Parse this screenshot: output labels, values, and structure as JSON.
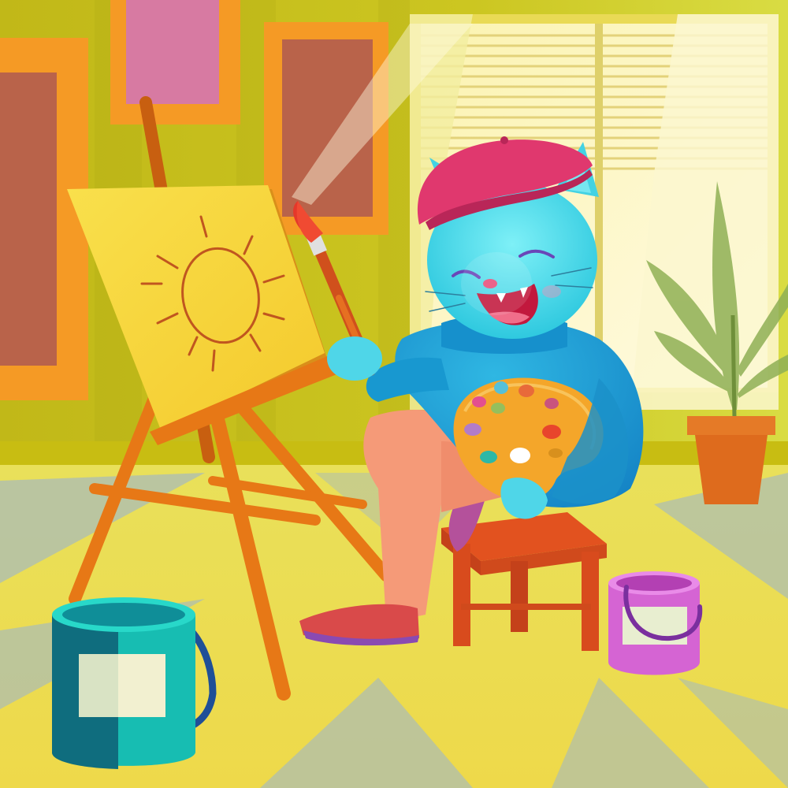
{
  "scene": {
    "subject": "cat-painter",
    "palette": {
      "wall": "#c9c31b",
      "wall_light": "#dcd93a",
      "floor_light": "#f3eb6a",
      "floor_blue": "#a9bcb8",
      "frame_orange": "#f59a25",
      "frame_pink": "#d77aa2",
      "frame_red": "#b9634a",
      "window_light": "#fff8c8",
      "easel_wood": "#e77816",
      "canvas": "#f7d73a",
      "sun_sketch": "#c0561f",
      "cat_fur": "#45d7e6",
      "sweater": "#1aa0d4",
      "pants": "#f59a78",
      "beret": "#e0386e",
      "shoe": "#d94a4a",
      "stool": "#e2521f",
      "palette_board": "#f4a62a",
      "teal_bucket": "#17bdb2",
      "pink_bucket": "#d564d3",
      "pot": "#de6b1d",
      "leaf": "#8fb055"
    },
    "icons": [
      "easel-icon",
      "paintbrush-icon",
      "palette-icon",
      "paint-bucket-icon",
      "plant-pot-icon",
      "beret-icon",
      "window-blinds-icon"
    ]
  }
}
